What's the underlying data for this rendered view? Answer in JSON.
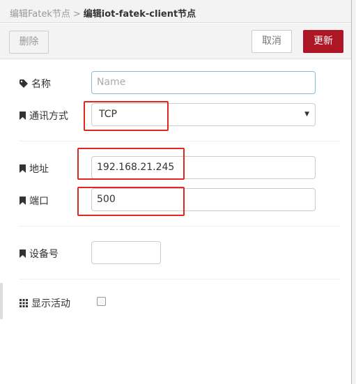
{
  "breadcrumb": {
    "parent": "编辑Fatek节点",
    "separator": ">",
    "current": "编辑iot-fatek-client节点"
  },
  "toolbar": {
    "delete_label": "删除",
    "cancel_label": "取消",
    "update_label": "更新"
  },
  "form": {
    "name": {
      "label": "名称",
      "placeholder": "Name",
      "value": "",
      "icon": "tag-icon"
    },
    "comm_mode": {
      "label": "通讯方式",
      "value": "TCP",
      "icon": "bookmark-icon"
    },
    "address": {
      "label": "地址",
      "value": "192.168.21.245",
      "icon": "bookmark-icon"
    },
    "port": {
      "label": "端口",
      "value": "500",
      "icon": "bookmark-icon"
    },
    "device_no": {
      "label": "设备号",
      "value": "",
      "icon": "bookmark-icon"
    },
    "show_activity": {
      "label": "显示活动",
      "checked": false,
      "icon": "grid-icon"
    }
  },
  "colors": {
    "accent": "#ad1625",
    "highlight": "#e0261f"
  }
}
